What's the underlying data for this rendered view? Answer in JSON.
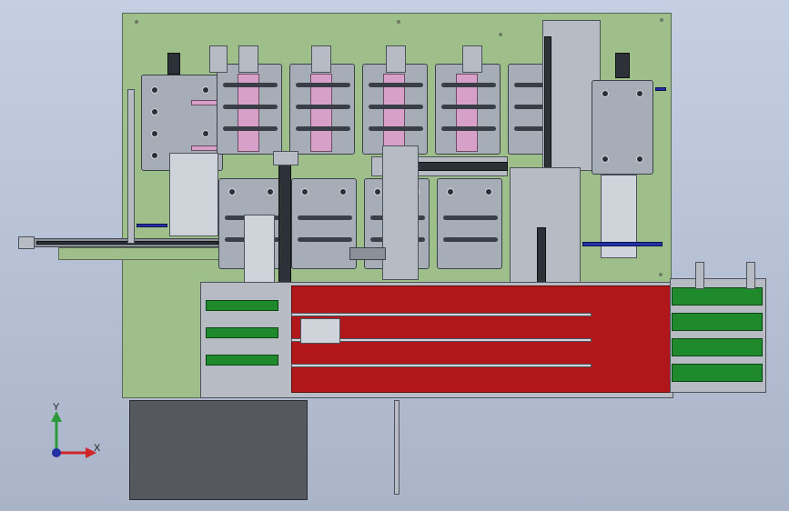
{
  "viewport": {
    "background_top": "#c5cfe3",
    "background_bottom": "#a9b4c9"
  },
  "model": {
    "base_plate_color": "#9fbf8a",
    "conveyor_color": "#b1171a",
    "output_strip_color": "#1f8a2b",
    "rail_color": "#2231a4"
  },
  "triad": {
    "y_label": "Y",
    "x_label": "X",
    "y_axis_color": "#2a9a3a",
    "x_axis_color": "#d0262a",
    "z_axis_color": "#2231a4"
  }
}
